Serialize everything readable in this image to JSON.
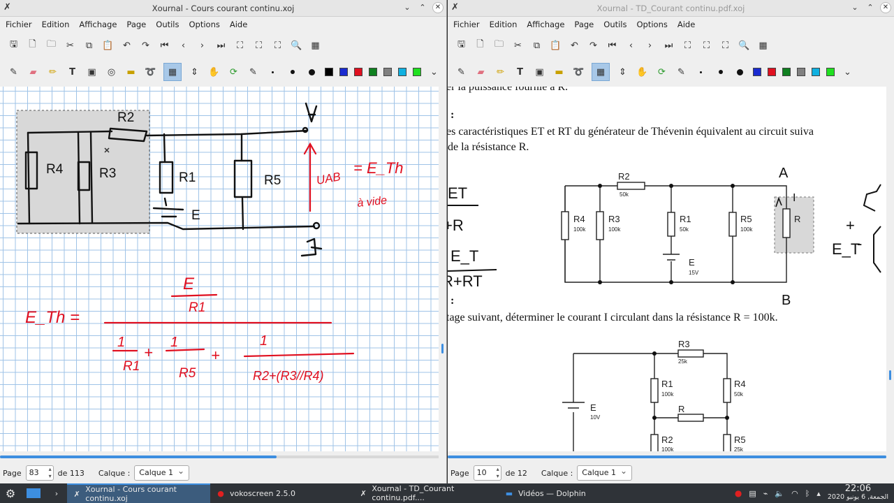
{
  "left_window": {
    "title": "Xournal - Cours courant continu.xoj",
    "menu": [
      "Fichier",
      "Edition",
      "Affichage",
      "Page",
      "Outils",
      "Options",
      "Aide"
    ],
    "status": {
      "page_label": "Page",
      "page_value": "83",
      "page_total": "de 113",
      "layer_label": "Calque :",
      "layer_value": "Calque 1"
    },
    "drawing": {
      "labels": [
        "R2",
        "A",
        "R4",
        "R3",
        "R1",
        "R5",
        "E",
        "B"
      ],
      "uab": "UAB",
      "eth": "= E_Th",
      "avide": "à vide",
      "formula_left": "E_Th =",
      "formula_num_top": "E",
      "formula_num_bot": "R1",
      "den_terms": [
        "1",
        "R1",
        "+",
        "1",
        "R5",
        "+",
        "1",
        "R2+(R3//R4)"
      ]
    }
  },
  "right_window": {
    "title": "Xournal - TD_Courant continu.pdf.xoj",
    "menu": [
      "Fichier",
      "Edition",
      "Affichage",
      "Page",
      "Outils",
      "Options",
      "Aide"
    ],
    "status": {
      "page_label": "Page",
      "page_value": "10",
      "page_total": "de 12",
      "layer_label": "Calque :",
      "layer_value": "Calque 1"
    },
    "pdf": {
      "line1": "er la puissance fournie à R.",
      "colon1": ":",
      "line2": "es caractéristiques ET et RT du générateur de Thévenin équivalent au circuit suiva",
      "line3": "de la résistance R.",
      "colon2": ":",
      "line4": "tage suivant, déterminer le courant I circulant dans la résistance R = 100k.",
      "circuit1": {
        "R2": "R2",
        "R2v": "50k",
        "R4": "R4",
        "R4v": "100k",
        "R3": "R3",
        "R3v": "100k",
        "R1": "R1",
        "R1v": "50k",
        "R5": "R5",
        "R5v": "100k",
        "E": "E",
        "Ev": "15V",
        "R": "R",
        "A": "A",
        "B": "B",
        "I": "I"
      },
      "circuit2": {
        "R3": "R3",
        "R3v": "25k",
        "R1": "R1",
        "R1v": "100k",
        "R4": "R4",
        "R4v": "50k",
        "R": "R",
        "R2": "R2",
        "R2v": "100k",
        "R5": "R5",
        "R5v": "25k",
        "E": "E",
        "Ev": "10V"
      },
      "hand": {
        "ET": "ET",
        "RT": "R+RT",
        "R": "+R",
        "E_T": "E_T",
        "plus": "+",
        "minus": "-"
      }
    }
  },
  "taskbar": {
    "tasks": [
      {
        "label": "Xournal - Cours courant continu.xoj",
        "active": true
      },
      {
        "label": "vokoscreen 2.5.0",
        "active": false
      },
      {
        "label": "Xournal - TD_Courant continu.pdf....",
        "active": false
      },
      {
        "label": "Vidéos — Dolphin",
        "active": false
      }
    ],
    "time": "22:06",
    "date": "الجمعة, 6 يونيو 2020"
  },
  "colors": {
    "accent": "#3d8ee0",
    "ink_red": "#e01020",
    "ink_black": "#111111",
    "selection": "#a8c8e8"
  }
}
